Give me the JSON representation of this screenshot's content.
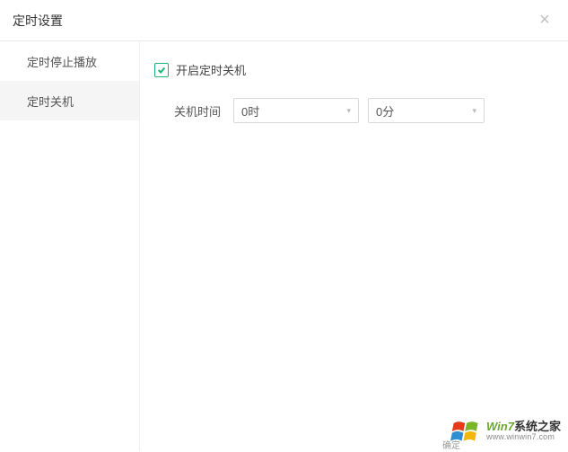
{
  "header": {
    "title": "定时设置"
  },
  "sidebar": {
    "items": [
      {
        "label": "定时停止播放",
        "active": false
      },
      {
        "label": "定时关机",
        "active": true
      }
    ]
  },
  "content": {
    "enable_label": "开启定时关机",
    "enable_checked": true,
    "time_label": "关机时间",
    "hour_value": "0时",
    "minute_value": "0分"
  },
  "watermark": {
    "line1_brand": "Win7",
    "line1_cn": "系统之家",
    "line2": "www.winwin7.com"
  },
  "footer": {
    "left_hint": "",
    "right_hint": "确定"
  }
}
